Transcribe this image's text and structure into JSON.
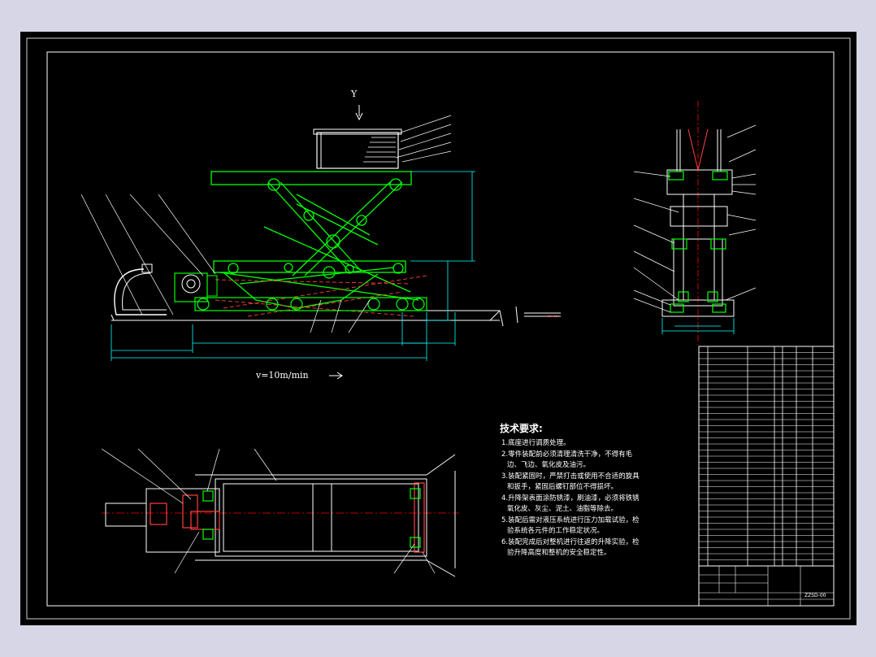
{
  "view_label": "Y",
  "speed_note": "v=10m/min",
  "tech_req": {
    "title": "技术要求:",
    "lines": [
      "1.底座进行调质处理。",
      "2.零件装配前必须清理清洗干净，不得有毛",
      "边、飞边、氧化皮及油污。",
      "3.装配紧固时，严禁打击或使用不合适的旋具",
      "和扳手，紧固后螺钉部位不得损坏。",
      "4.升降架表面涂防锈漆，刷油漆，必须将铁锈",
      "氧化皮、灰尘、泥土、油脂等除去。",
      "5.装配后需对液压系统进行压力加载试验，检",
      "验系统各元件的工作稳定状况。",
      "6.装配完成后对整机进行往返的升降实验，检",
      "验升降高度和整机的安全稳定性。"
    ]
  },
  "title_block": {
    "drawing_no": "ZZSD-00"
  },
  "colors": {
    "background": "#000000",
    "frame": "#ffffff",
    "structure": "#00ff00",
    "dimension": "#00ffff",
    "centerline": "#ff0000",
    "mechanism": "#ff4040",
    "leader": "#ffffff",
    "outer": "#d6d6e6"
  }
}
